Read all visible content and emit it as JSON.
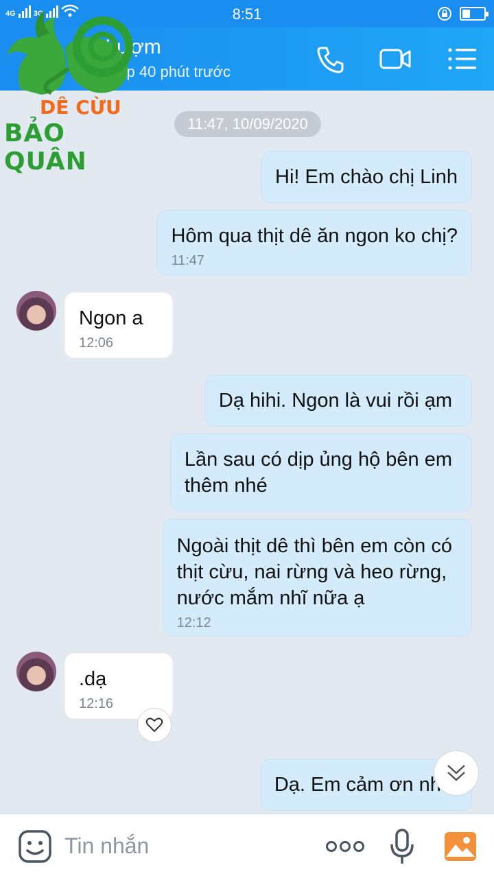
{
  "status_bar": {
    "network_1": "4G",
    "network_2": "3G",
    "time": "8:51",
    "battery_level": 0.35
  },
  "header": {
    "contact_name": "Lì Lượm",
    "last_seen": "Truy cập 40 phút trước",
    "icons": [
      "phone-icon",
      "video-call-icon",
      "menu-icon"
    ]
  },
  "logo": {
    "line1": "DÊ CỪU",
    "line2": "BẢO QUÂN"
  },
  "chat": {
    "date_chip": "11:47, 10/09/2020",
    "messages": [
      {
        "side": "out",
        "text": "Hi!  Em chào chị Linh",
        "time": ""
      },
      {
        "side": "out",
        "text": "Hôm qua thịt dê ăn ngon ko chị?",
        "time": "11:47"
      },
      {
        "side": "in",
        "text": "Ngon a",
        "time": "12:06"
      },
      {
        "side": "out",
        "text": "Dạ hihi.  Ngon là vui rồi ạm",
        "time": ""
      },
      {
        "side": "out",
        "text_lines": [
          "Lần sau có dịp ủng hộ bên em",
          "thêm nhé"
        ],
        "time": ""
      },
      {
        "side": "out",
        "text_lines": [
          "Ngoài thịt dê thì bên em còn có",
          "thịt cừu,  nai rừng và heo rừng,",
          "nước mắm nhĩ nữa ạ"
        ],
        "time": "12:12"
      },
      {
        "side": "in",
        "text": ".dạ",
        "time": "12:16"
      },
      {
        "side": "out",
        "text": "Dạ.  Em cảm ơn nhé",
        "time": ""
      }
    ]
  },
  "input_bar": {
    "placeholder": "Tin nhắn",
    "icons": [
      "emoji-icon",
      "more-icon",
      "microphone-icon",
      "image-icon"
    ]
  },
  "colors": {
    "header_blue": "#1a8df0",
    "outgoing_bubble": "#d4ebfb",
    "incoming_bubble": "#ffffff",
    "background": "#e2e9f1",
    "logo_orange": "#f26b1d",
    "logo_green": "#2d9e33"
  }
}
